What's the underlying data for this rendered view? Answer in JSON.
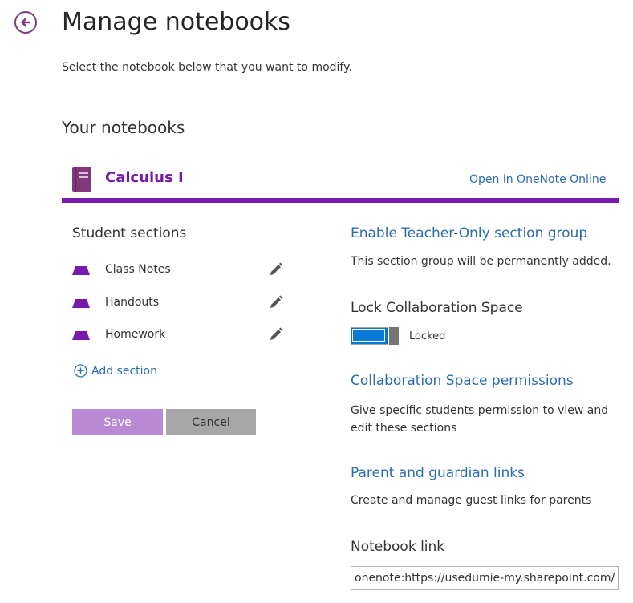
{
  "header": {
    "title": "Manage notebooks",
    "subtitle": "Select the notebook below that you want to modify.",
    "your_notebooks": "Your notebooks"
  },
  "notebook": {
    "name": "Calculus I",
    "open_link": "Open in OneNote Online",
    "accent_color": "#7719aa"
  },
  "sections": {
    "heading": "Student sections",
    "items": [
      {
        "label": "Class Notes"
      },
      {
        "label": "Handouts"
      },
      {
        "label": "Homework"
      }
    ],
    "add_label": "Add section"
  },
  "buttons": {
    "save": "Save",
    "cancel": "Cancel"
  },
  "right": {
    "teacher_only_link": "Enable Teacher-Only section group",
    "teacher_only_desc": "This section group will be permanently added.",
    "lock_heading": "Lock Collaboration Space",
    "lock_state": "Locked",
    "lock_on": true,
    "permissions_link": "Collaboration Space permissions",
    "permissions_desc": "Give specific students permission to view and edit these sections",
    "parent_link": "Parent and guardian links",
    "parent_desc": "Create and manage guest links for parents",
    "notebook_link_heading": "Notebook link",
    "notebook_link_value": "onenote:https://usedumie-my.sharepoint.com/p"
  },
  "icons": {
    "back": "back-arrow-icon",
    "notebook": "notebook-icon",
    "section": "section-tab-icon",
    "edit": "pencil-icon",
    "add": "plus-circle-icon"
  }
}
